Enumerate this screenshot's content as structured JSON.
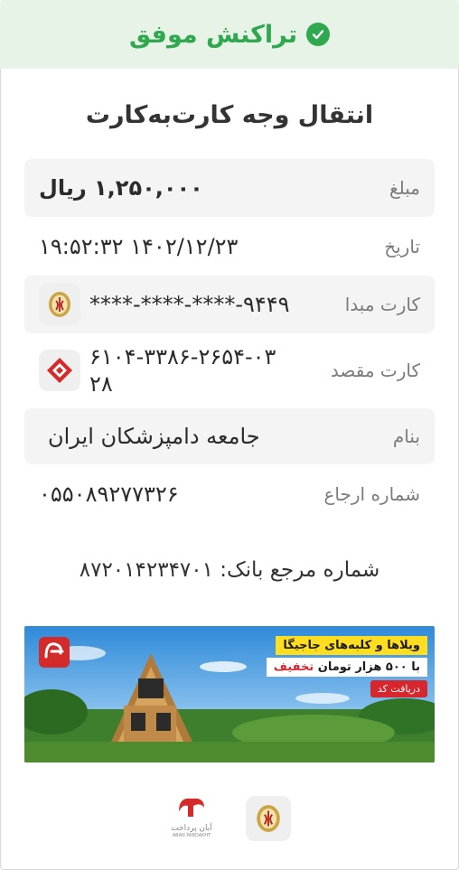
{
  "status": {
    "title": "تراکنش موفق",
    "color": "#2fa84f"
  },
  "receipt": {
    "title": "انتقال وجه کارت‌به‌کارت"
  },
  "rows": {
    "amount": {
      "label": "مبلغ",
      "value": "۱,۲۵۰,۰۰۰ ریال"
    },
    "date": {
      "label": "تاریخ",
      "value": "۱۹:۵۲:۳۲ ۱۴۰۲/۱۲/۲۳"
    },
    "source_card": {
      "label": "کارت مبدا",
      "value": "****-****-****-۹۴۴۹",
      "bank_icon": "bank-melli-icon"
    },
    "dest_card": {
      "label": "کارت مقصد",
      "value_line1": "۶۱۰۴-۳۳۸۶-۲۶۵۴-۰۳",
      "value_line2": "۲۸",
      "bank_icon": "bank-mellat-icon"
    },
    "name": {
      "label": "بنام",
      "value": "جامعه دامپزشکان ایران"
    },
    "tracking": {
      "label": "شماره ارجاع",
      "value": "۰۵۵۰۸۹۲۷۷۳۲۶"
    }
  },
  "bank_reference": {
    "text": "شماره مرجع بانک: ۸۷۲۰۱۴۲۳۴۷۰۱"
  },
  "banner": {
    "line1": "ویلاها و کلبه‌های جاجیگا",
    "line2_prefix": "با ۵۰۰ هزار تومان",
    "line2_highlight": "تخفیف",
    "cta": "دریافت کد"
  },
  "footer": {
    "aban_text": "آبان پرداخت",
    "aban_latin": "ABAN PARDAKHT"
  }
}
